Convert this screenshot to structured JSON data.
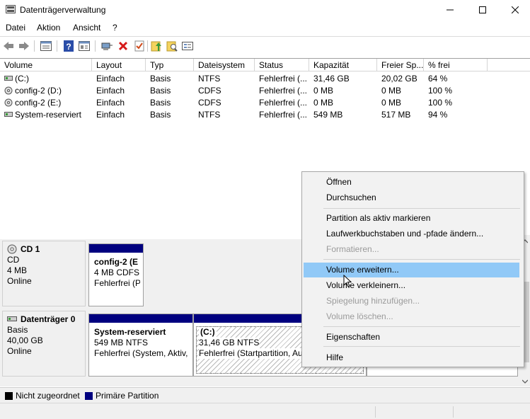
{
  "window": {
    "title": "Datenträgerverwaltung"
  },
  "menu": [
    "Datei",
    "Aktion",
    "Ansicht",
    "?"
  ],
  "toolbar": {
    "buttons": [
      "back-icon",
      "forward-icon",
      "list-view-icon",
      "help-icon",
      "properties-icon",
      "connect-icon",
      "delete-icon",
      "check-icon",
      "up-icon",
      "search-icon",
      "settings-icon"
    ]
  },
  "volume_table": {
    "headers": [
      "Volume",
      "Layout",
      "Typ",
      "Dateisystem",
      "Status",
      "Kapazität",
      "Freier Sp...",
      "% frei"
    ],
    "rows": [
      [
        "(C:)",
        "Einfach",
        "Basis",
        "NTFS",
        "Fehlerfrei (...",
        "31,46 GB",
        "20,02 GB",
        "64 %"
      ],
      [
        "config-2 (D:)",
        "Einfach",
        "Basis",
        "CDFS",
        "Fehlerfrei (...",
        "0 MB",
        "0 MB",
        "100 %"
      ],
      [
        "config-2 (E:)",
        "Einfach",
        "Basis",
        "CDFS",
        "Fehlerfrei (...",
        "0 MB",
        "0 MB",
        "100 %"
      ],
      [
        "System-reserviert",
        "Einfach",
        "Basis",
        "NTFS",
        "Fehlerfrei (...",
        "549 MB",
        "517 MB",
        "94 %"
      ]
    ]
  },
  "disks": {
    "cd1": {
      "name": "CD 1",
      "type": "CD",
      "size": "4 MB",
      "state": "Online",
      "partition": {
        "name": "config-2  (E",
        "detail": "4 MB CDFS",
        "status": "Fehlerfrei (P"
      }
    },
    "disk0": {
      "name": "Datenträger 0",
      "type": "Basis",
      "size": "40,00 GB",
      "state": "Online",
      "partitions": [
        {
          "name": "System-reserviert",
          "detail": "549 MB NTFS",
          "status": "Fehlerfrei (System, Aktiv,"
        },
        {
          "name": "(C:)",
          "detail": "31,46 GB NTFS",
          "status": "Fehlerfrei (Startpartition, Au"
        }
      ]
    }
  },
  "legend": {
    "unallocated": "Nicht zugeordnet",
    "primary": "Primäre Partition"
  },
  "colors": {
    "primary_partition": "#00007f",
    "unallocated": "#000000",
    "menu_highlight": "#91c9f7"
  },
  "context_menu": {
    "items": [
      {
        "label": "Öffnen",
        "enabled": true
      },
      {
        "label": "Durchsuchen",
        "enabled": true
      },
      {
        "label": "Partition als aktiv markieren",
        "enabled": true
      },
      {
        "label": "Laufwerkbuchstaben und -pfade ändern...",
        "enabled": true
      },
      {
        "label": "Formatieren...",
        "enabled": false
      },
      {
        "label": "Volume erweitern...",
        "enabled": true,
        "highlighted": true
      },
      {
        "label": "Volume verkleinern...",
        "enabled": true
      },
      {
        "label": "Spiegelung hinzufügen...",
        "enabled": false
      },
      {
        "label": "Volume löschen...",
        "enabled": false
      },
      {
        "label": "Eigenschaften",
        "enabled": true
      },
      {
        "label": "Hilfe",
        "enabled": true
      }
    ]
  }
}
